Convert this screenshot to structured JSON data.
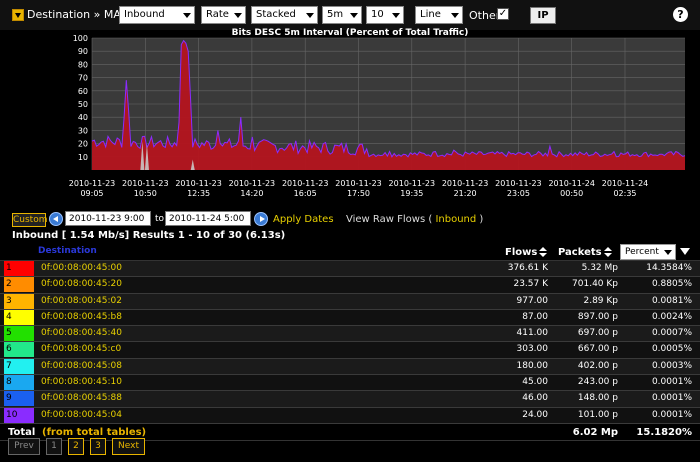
{
  "toolbar": {
    "breadcrumb": "Destination » MACs",
    "direction": "Inbound",
    "metric": "Rate",
    "mode": "Stacked",
    "interval": "5m",
    "top_n": "10",
    "chart_style": "Line",
    "other_label": "Other",
    "other_checked": "✓",
    "ip_button": "IP",
    "help": "?"
  },
  "chart_data": {
    "type": "area",
    "title": "Bits DESC  5m Interval (Percent of Total Traffic)",
    "ylim": [
      0,
      100
    ],
    "yticks": [
      "100",
      "90",
      "80",
      "70",
      "60",
      "50",
      "40",
      "30",
      "20",
      "10"
    ],
    "xticks": [
      [
        "2010-11-23",
        "09:05"
      ],
      [
        "2010-11-23",
        "10:50"
      ],
      [
        "2010-11-23",
        "12:35"
      ],
      [
        "2010-11-23",
        "14:20"
      ],
      [
        "2010-11-23",
        "16:05"
      ],
      [
        "2010-11-23",
        "17:50"
      ],
      [
        "2010-11-23",
        "19:35"
      ],
      [
        "2010-11-23",
        "21:20"
      ],
      [
        "2010-11-23",
        "23:05"
      ],
      [
        "2010-11-24",
        "00:50"
      ],
      [
        "2010-11-24",
        "02:35"
      ]
    ],
    "grid": true,
    "colors": {
      "fill": "#b4141e",
      "line": "#8a2cff",
      "secondary": "#c8b4b4"
    }
  },
  "daterange": {
    "custom_label": "Custom",
    "start": "2010-11-23 9:00",
    "to_label": "to",
    "end": "2010-11-24 5:00",
    "apply_label": "Apply Dates",
    "raw_prefix": "View Raw Flows (",
    "raw_link": "Inbound",
    "raw_suffix": ")"
  },
  "summary": "Inbound [ 1.54 Mb/s] Results 1 - 10 of 30 (6.13s)",
  "table": {
    "col_destination": "Destination",
    "col_flows": "Flows",
    "col_packets": "Packets",
    "col_percent": "Percent",
    "rows": [
      {
        "idx": "1",
        "color": "#ff0000",
        "mac": "0f:00:08:00:45:00",
        "flows": "376.61 K",
        "packets": "5.32 Mp",
        "percent": "14.3584%"
      },
      {
        "idx": "2",
        "color": "#ff8c00",
        "mac": "0f:00:08:00:45:20",
        "flows": "23.57 K",
        "packets": "701.40 Kp",
        "percent": "0.8805%"
      },
      {
        "idx": "3",
        "color": "#ffb400",
        "mac": "0f:00:08:00:45:02",
        "flows": "977.00",
        "packets": "2.89 Kp",
        "percent": "0.0081%"
      },
      {
        "idx": "4",
        "color": "#ffff00",
        "mac": "0f:00:08:00:45:b8",
        "flows": "87.00",
        "packets": "897.00 p",
        "percent": "0.0024%"
      },
      {
        "idx": "5",
        "color": "#22e000",
        "mac": "0f:00:08:00:45:40",
        "flows": "411.00",
        "packets": "697.00 p",
        "percent": "0.0007%"
      },
      {
        "idx": "6",
        "color": "#22e88a",
        "mac": "0f:00:08:00:45:c0",
        "flows": "303.00",
        "packets": "667.00 p",
        "percent": "0.0005%"
      },
      {
        "idx": "7",
        "color": "#22f0f0",
        "mac": "0f:00:08:00:45:08",
        "flows": "180.00",
        "packets": "402.00 p",
        "percent": "0.0003%"
      },
      {
        "idx": "8",
        "color": "#1aa8f0",
        "mac": "0f:00:08:00:45:10",
        "flows": "45.00",
        "packets": "243.00 p",
        "percent": "0.0001%"
      },
      {
        "idx": "9",
        "color": "#1a60f0",
        "mac": "0f:00:08:00:45:88",
        "flows": "46.00",
        "packets": "148.00 p",
        "percent": "0.0001%"
      },
      {
        "idx": "10",
        "color": "#8a2cff",
        "mac": "0f:00:08:00:45:04",
        "flows": "24.00",
        "packets": "101.00 p",
        "percent": "0.0001%"
      }
    ],
    "total_label": "Total",
    "total_note": "(from total tables)",
    "total_packets": "6.02 Mp",
    "total_percent": "15.1820%"
  },
  "pager": {
    "prev": "Prev",
    "p1": "1",
    "p2": "2",
    "p3": "3",
    "next": "Next"
  }
}
